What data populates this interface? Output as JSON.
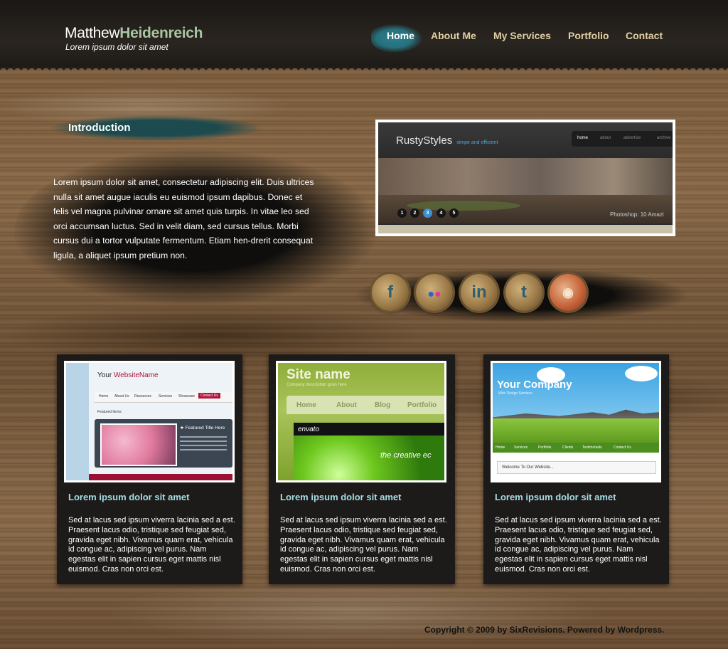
{
  "header": {
    "logo_first": "Matthew",
    "logo_last": "Heidenreich",
    "tagline": "Lorem ipsum dolor sit amet",
    "nav": [
      "Home",
      "About Me",
      "My Services",
      "Portfolio",
      "Contact"
    ],
    "active_nav": "Home"
  },
  "intro": {
    "title": "Introduction",
    "text": "Lorem ipsum dolor sit amet, consectetur adipiscing elit. Duis ultrices nulla sit amet augue iaculis eu euismod ipsum dapibus. Donec et felis vel magna pulvinar ornare sit amet quis turpis. In vitae leo sed orci accumsan luctus. Sed in velit diam, sed cursus tellus. Morbi cursus dui a tortor vulputate fermentum. Etiam hen-drerit consequat ligula, a aliquet ipsum pretium non."
  },
  "slider": {
    "brand": "RustyStyles",
    "brand_sub": "simpe and efficient",
    "menu": [
      "home",
      "about",
      "advertise",
      "archive"
    ],
    "dots": [
      "1",
      "2",
      "3",
      "4",
      "5"
    ],
    "active_dot": "3",
    "caption": "Photoshop: 10 Amazi"
  },
  "social": {
    "icons": [
      "facebook-icon",
      "flickr-icon",
      "linkedin-icon",
      "twitter-icon",
      "rss-icon"
    ]
  },
  "cards": [
    {
      "title": "Lorem ipsum dolor sit amet",
      "text": "Sed at lacus sed ipsum viverra lacinia sed a est. Praesent lacus odio, tristique sed feugiat sed, gravida eget nibh. Vivamus quam erat, vehicula id congue ac, adipiscing vel purus. Nam egestas elit in sapien cursus eget mattis nisl euismod. Cras non orci est.",
      "thumb": {
        "brand_a": "Your ",
        "brand_b": "WebsiteName",
        "menu": [
          "Home",
          "About Us",
          "Resources",
          "Services",
          "Showcase",
          "Contact Us"
        ],
        "label": "Featured Items",
        "feature_title": "★ Featured Title Here"
      }
    },
    {
      "title": "Lorem ipsum dolor sit amet",
      "text": "Sed at lacus sed ipsum viverra lacinia sed a est. Praesent lacus odio, tristique sed feugiat sed, gravida eget nibh. Vivamus quam erat, vehicula id congue ac, adipiscing vel purus. Nam egestas elit in sapien cursus eget mattis nisl euismod. Cras non orci est.",
      "thumb": {
        "site_name": "Site name",
        "site_sub": "Company description goes here",
        "menu": [
          "Home",
          "About",
          "Blog",
          "Portfolio"
        ],
        "envato": "envato",
        "tag": "the creative ec"
      }
    },
    {
      "title": "Lorem ipsum dolor sit amet",
      "text": "Sed at lacus sed ipsum viverra lacinia sed a est. Praesent lacus odio, tristique sed feugiat sed, gravida eget nibh. Vivamus quam erat, vehicula id congue ac, adipiscing vel purus. Nam egestas elit in sapien cursus eget mattis nisl euismod. Cras non orci est.",
      "thumb": {
        "company": "Your Company",
        "company_sub": "Web Design Services",
        "menu": [
          "Home",
          "Services",
          "Portfolio",
          "Clients",
          "Testimonials",
          "Contact Us"
        ],
        "welcome": "Welcome To Our Website..."
      }
    }
  ],
  "footer": "Copyright © 2009 by SixRevisions. Powered by Wordpress.",
  "colors": {
    "nav_text": "#e0cfa2",
    "accent_teal": "#26707c",
    "card_title": "#a6dde3",
    "card_bg": "#1d1b19"
  }
}
